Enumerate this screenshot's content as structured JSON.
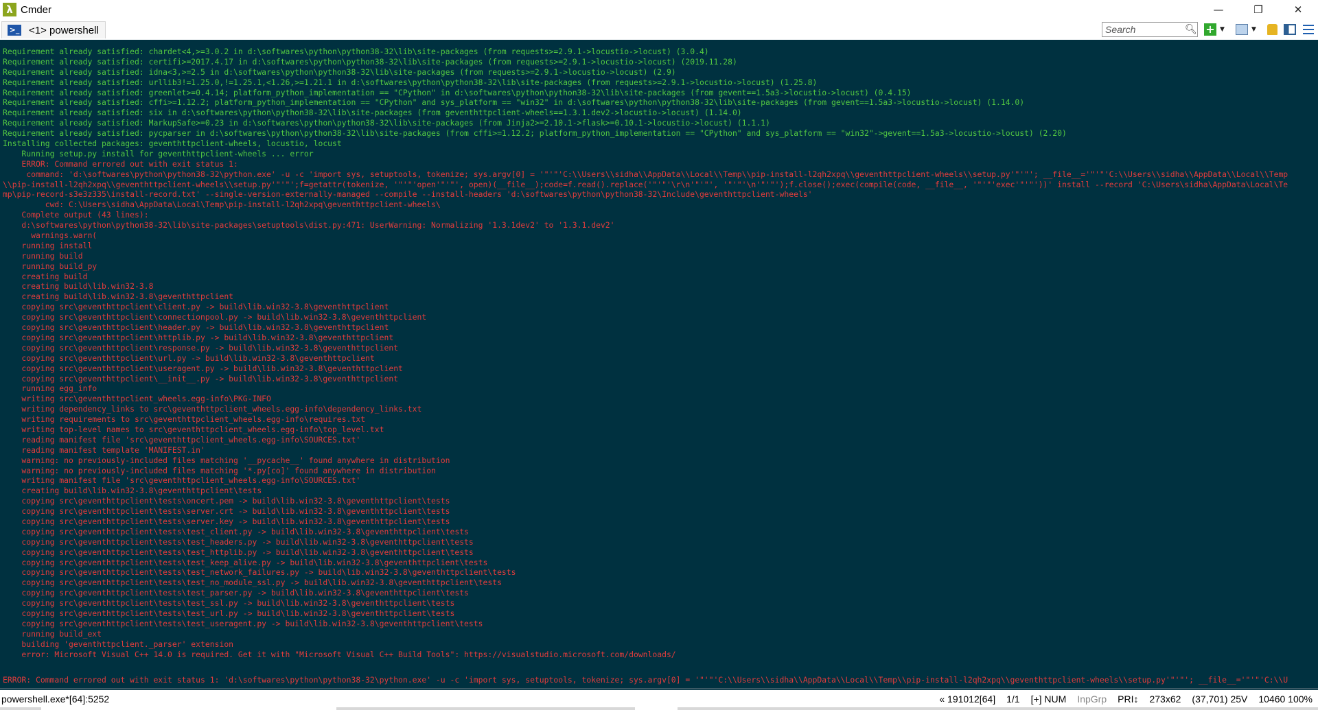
{
  "window": {
    "title": "Cmder",
    "app_icon_glyph": "λ",
    "controls": [
      "—",
      "❐",
      "✕"
    ]
  },
  "tab": {
    "label": "<1> powershell",
    "icon_glyph": ">_"
  },
  "search": {
    "placeholder": "Search"
  },
  "colors": {
    "console_bg": "#003140",
    "text_green": "#52c741",
    "text_red": "#e23c3c"
  },
  "console": {
    "lines": [
      {
        "t": "Requirement already satisfied: chardet<4,>=3.0.2 in d:\\softwares\\python\\python38-32\\lib\\site-packages (from requests>=2.9.1->locustio->locust) (3.0.4)",
        "c": "green"
      },
      {
        "t": "Requirement already satisfied: certifi>=2017.4.17 in d:\\softwares\\python\\python38-32\\lib\\site-packages (from requests>=2.9.1->locustio->locust) (2019.11.28)",
        "c": "green"
      },
      {
        "t": "Requirement already satisfied: idna<3,>=2.5 in d:\\softwares\\python\\python38-32\\lib\\site-packages (from requests>=2.9.1->locustio->locust) (2.9)",
        "c": "green"
      },
      {
        "t": "Requirement already satisfied: urllib3!=1.25.0,!=1.25.1,<1.26,>=1.21.1 in d:\\softwares\\python\\python38-32\\lib\\site-packages (from requests>=2.9.1->locustio->locust) (1.25.8)",
        "c": "green"
      },
      {
        "t": "Requirement already satisfied: greenlet>=0.4.14; platform_python_implementation == \"CPython\" in d:\\softwares\\python\\python38-32\\lib\\site-packages (from gevent==1.5a3->locustio->locust) (0.4.15)",
        "c": "green"
      },
      {
        "t": "Requirement already satisfied: cffi>=1.12.2; platform_python_implementation == \"CPython\" and sys_platform == \"win32\" in d:\\softwares\\python\\python38-32\\lib\\site-packages (from gevent==1.5a3->locustio->locust) (1.14.0)",
        "c": "green"
      },
      {
        "t": "Requirement already satisfied: six in d:\\softwares\\python\\python38-32\\lib\\site-packages (from geventhttpclient-wheels==1.3.1.dev2->locustio->locust) (1.14.0)",
        "c": "green"
      },
      {
        "t": "Requirement already satisfied: MarkupSafe>=0.23 in d:\\softwares\\python\\python38-32\\lib\\site-packages (from Jinja2>=2.10.1->flask>=0.10.1->locustio->locust) (1.1.1)",
        "c": "green"
      },
      {
        "t": "Requirement already satisfied: pycparser in d:\\softwares\\python\\python38-32\\lib\\site-packages (from cffi>=1.12.2; platform_python_implementation == \"CPython\" and sys_platform == \"win32\"->gevent==1.5a3->locustio->locust) (2.20)",
        "c": "green"
      },
      {
        "t": "Installing collected packages: geventhttpclient-wheels, locustio, locust",
        "c": "green"
      },
      {
        "t": "    Running setup.py install for geventhttpclient-wheels ... error",
        "c": "green"
      },
      {
        "t": "    ERROR: Command errored out with exit status 1:",
        "c": "red"
      },
      {
        "t": "     command: 'd:\\softwares\\python\\python38-32\\python.exe' -u -c 'import sys, setuptools, tokenize; sys.argv[0] = '\"'\"'C:\\\\Users\\\\sidha\\\\AppData\\\\Local\\\\Temp\\\\pip-install-l2qh2xpq\\\\geventhttpclient-wheels\\\\setup.py'\"'\"'; __file__='\"'\"'C:\\\\Users\\\\sidha\\\\AppData\\\\Local\\\\Temp",
        "c": "red"
      },
      {
        "t": "\\\\pip-install-l2qh2xpq\\\\geventhttpclient-wheels\\\\setup.py'\"'\"';f=getattr(tokenize, '\"'\"'open'\"'\"', open)(__file__);code=f.read().replace('\"'\"'\\r\\n'\"'\"', '\"'\"'\\n'\"'\"');f.close();exec(compile(code, __file__, '\"'\"'exec'\"'\"'))' install --record 'C:\\Users\\sidha\\AppData\\Local\\Te",
        "c": "red"
      },
      {
        "t": "mp\\pip-record-s3e3z335\\install-record.txt' --single-version-externally-managed --compile --install-headers 'd:\\softwares\\python\\python38-32\\Include\\geventhttpclient-wheels'",
        "c": "red"
      },
      {
        "t": "         cwd: C:\\Users\\sidha\\AppData\\Local\\Temp\\pip-install-l2qh2xpq\\geventhttpclient-wheels\\",
        "c": "red"
      },
      {
        "t": "    Complete output (43 lines):",
        "c": "red"
      },
      {
        "t": "    d:\\softwares\\python\\python38-32\\lib\\site-packages\\setuptools\\dist.py:471: UserWarning: Normalizing '1.3.1dev2' to '1.3.1.dev2'",
        "c": "red"
      },
      {
        "t": "      warnings.warn(",
        "c": "red"
      },
      {
        "t": "    running install",
        "c": "red"
      },
      {
        "t": "    running build",
        "c": "red"
      },
      {
        "t": "    running build_py",
        "c": "red"
      },
      {
        "t": "    creating build",
        "c": "red"
      },
      {
        "t": "    creating build\\lib.win32-3.8",
        "c": "red"
      },
      {
        "t": "    creating build\\lib.win32-3.8\\geventhttpclient",
        "c": "red"
      },
      {
        "t": "    copying src\\geventhttpclient\\client.py -> build\\lib.win32-3.8\\geventhttpclient",
        "c": "red"
      },
      {
        "t": "    copying src\\geventhttpclient\\connectionpool.py -> build\\lib.win32-3.8\\geventhttpclient",
        "c": "red"
      },
      {
        "t": "    copying src\\geventhttpclient\\header.py -> build\\lib.win32-3.8\\geventhttpclient",
        "c": "red"
      },
      {
        "t": "    copying src\\geventhttpclient\\httplib.py -> build\\lib.win32-3.8\\geventhttpclient",
        "c": "red"
      },
      {
        "t": "    copying src\\geventhttpclient\\response.py -> build\\lib.win32-3.8\\geventhttpclient",
        "c": "red"
      },
      {
        "t": "    copying src\\geventhttpclient\\url.py -> build\\lib.win32-3.8\\geventhttpclient",
        "c": "red"
      },
      {
        "t": "    copying src\\geventhttpclient\\useragent.py -> build\\lib.win32-3.8\\geventhttpclient",
        "c": "red"
      },
      {
        "t": "    copying src\\geventhttpclient\\__init__.py -> build\\lib.win32-3.8\\geventhttpclient",
        "c": "red"
      },
      {
        "t": "    running egg_info",
        "c": "red"
      },
      {
        "t": "    writing src\\geventhttpclient_wheels.egg-info\\PKG-INFO",
        "c": "red"
      },
      {
        "t": "    writing dependency_links to src\\geventhttpclient_wheels.egg-info\\dependency_links.txt",
        "c": "red"
      },
      {
        "t": "    writing requirements to src\\geventhttpclient_wheels.egg-info\\requires.txt",
        "c": "red"
      },
      {
        "t": "    writing top-level names to src\\geventhttpclient_wheels.egg-info\\top_level.txt",
        "c": "red"
      },
      {
        "t": "    reading manifest file 'src\\geventhttpclient_wheels.egg-info\\SOURCES.txt'",
        "c": "red"
      },
      {
        "t": "    reading manifest template 'MANIFEST.in'",
        "c": "red"
      },
      {
        "t": "    warning: no previously-included files matching '__pycache__' found anywhere in distribution",
        "c": "red"
      },
      {
        "t": "    warning: no previously-included files matching '*.py[co]' found anywhere in distribution",
        "c": "red"
      },
      {
        "t": "    writing manifest file 'src\\geventhttpclient_wheels.egg-info\\SOURCES.txt'",
        "c": "red"
      },
      {
        "t": "    creating build\\lib.win32-3.8\\geventhttpclient\\tests",
        "c": "red"
      },
      {
        "t": "    copying src\\geventhttpclient\\tests\\oncert.pem -> build\\lib.win32-3.8\\geventhttpclient\\tests",
        "c": "red"
      },
      {
        "t": "    copying src\\geventhttpclient\\tests\\server.crt -> build\\lib.win32-3.8\\geventhttpclient\\tests",
        "c": "red"
      },
      {
        "t": "    copying src\\geventhttpclient\\tests\\server.key -> build\\lib.win32-3.8\\geventhttpclient\\tests",
        "c": "red"
      },
      {
        "t": "    copying src\\geventhttpclient\\tests\\test_client.py -> build\\lib.win32-3.8\\geventhttpclient\\tests",
        "c": "red"
      },
      {
        "t": "    copying src\\geventhttpclient\\tests\\test_headers.py -> build\\lib.win32-3.8\\geventhttpclient\\tests",
        "c": "red"
      },
      {
        "t": "    copying src\\geventhttpclient\\tests\\test_httplib.py -> build\\lib.win32-3.8\\geventhttpclient\\tests",
        "c": "red"
      },
      {
        "t": "    copying src\\geventhttpclient\\tests\\test_keep_alive.py -> build\\lib.win32-3.8\\geventhttpclient\\tests",
        "c": "red"
      },
      {
        "t": "    copying src\\geventhttpclient\\tests\\test_network_failures.py -> build\\lib.win32-3.8\\geventhttpclient\\tests",
        "c": "red"
      },
      {
        "t": "    copying src\\geventhttpclient\\tests\\test_no_module_ssl.py -> build\\lib.win32-3.8\\geventhttpclient\\tests",
        "c": "red"
      },
      {
        "t": "    copying src\\geventhttpclient\\tests\\test_parser.py -> build\\lib.win32-3.8\\geventhttpclient\\tests",
        "c": "red"
      },
      {
        "t": "    copying src\\geventhttpclient\\tests\\test_ssl.py -> build\\lib.win32-3.8\\geventhttpclient\\tests",
        "c": "red"
      },
      {
        "t": "    copying src\\geventhttpclient\\tests\\test_url.py -> build\\lib.win32-3.8\\geventhttpclient\\tests",
        "c": "red"
      },
      {
        "t": "    copying src\\geventhttpclient\\tests\\test_useragent.py -> build\\lib.win32-3.8\\geventhttpclient\\tests",
        "c": "red"
      },
      {
        "t": "    running build_ext",
        "c": "red"
      },
      {
        "t": "    building 'geventhttpclient._parser' extension",
        "c": "red"
      },
      {
        "t": "    error: Microsoft Visual C++ 14.0 is required. Get it with \"Microsoft Visual C++ Build Tools\": https://visualstudio.microsoft.com/downloads/",
        "c": "red"
      }
    ],
    "final_error": "ERROR: Command errored out with exit status 1: 'd:\\softwares\\python\\python38-32\\python.exe' -u -c 'import sys, setuptools, tokenize; sys.argv[0] = '\"'\"'C:\\\\Users\\\\sidha\\\\AppData\\\\Local\\\\Temp\\\\pip-install-l2qh2xpq\\\\geventhttpclient-wheels\\\\setup.py'\"'\"'; __file__='\"'\"'C:\\\\U"
  },
  "statusbar": {
    "process": "powershell.exe*[64]:5252",
    "items": [
      {
        "text": "« 191012[64]",
        "dim": false
      },
      {
        "text": "1/1",
        "dim": false
      },
      {
        "text": "[+] NUM",
        "dim": false
      },
      {
        "text": "InpGrp",
        "dim": true
      },
      {
        "text": "PRI↕",
        "dim": false
      },
      {
        "text": "273x62",
        "dim": false
      },
      {
        "text": "(37,701) 25V",
        "dim": false
      },
      {
        "text": "10460 100%",
        "dim": false
      }
    ]
  }
}
